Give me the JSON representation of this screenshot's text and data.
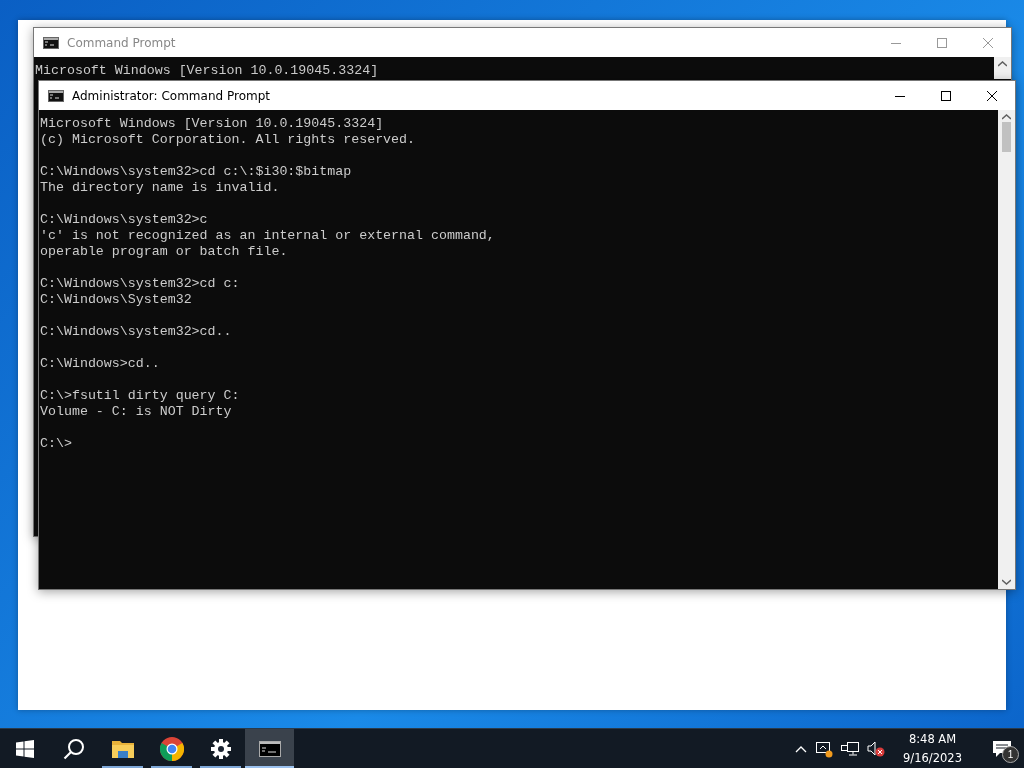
{
  "windows": [
    {
      "title": "Command Prompt",
      "active": false,
      "blocks": [
        [
          "Microsoft Windows [Version 10.0.19045.3324]"
        ]
      ]
    },
    {
      "title": "Administrator: Command Prompt",
      "active": true,
      "blocks": [
        [
          "Microsoft Windows [Version 10.0.19045.3324]",
          "(c) Microsoft Corporation. All rights reserved."
        ],
        [
          "C:\\Windows\\system32>cd c:\\:$i30:$bitmap",
          "The directory name is invalid."
        ],
        [
          "C:\\Windows\\system32>c",
          "'c' is not recognized as an internal or external command,",
          "operable program or batch file."
        ],
        [
          "C:\\Windows\\system32>cd c:",
          "C:\\Windows\\System32"
        ],
        [
          "C:\\Windows\\system32>cd.."
        ],
        [
          "C:\\Windows>cd.."
        ],
        [
          "C:\\>fsutil dirty query C:",
          "Volume - C: is NOT Dirty"
        ],
        [
          "C:\\>"
        ]
      ]
    }
  ],
  "taskbar": {
    "items": [
      {
        "kind": "start",
        "running": false,
        "selected": false
      },
      {
        "kind": "search",
        "running": false,
        "selected": false
      },
      {
        "kind": "folder",
        "running": true,
        "selected": false
      },
      {
        "kind": "browser",
        "running": true,
        "selected": false
      },
      {
        "kind": "settings",
        "running": true,
        "selected": false
      },
      {
        "kind": "terminal",
        "running": true,
        "selected": true
      }
    ],
    "time": "8:48 AM",
    "date": "9/16/2023",
    "notification_count": "1"
  }
}
